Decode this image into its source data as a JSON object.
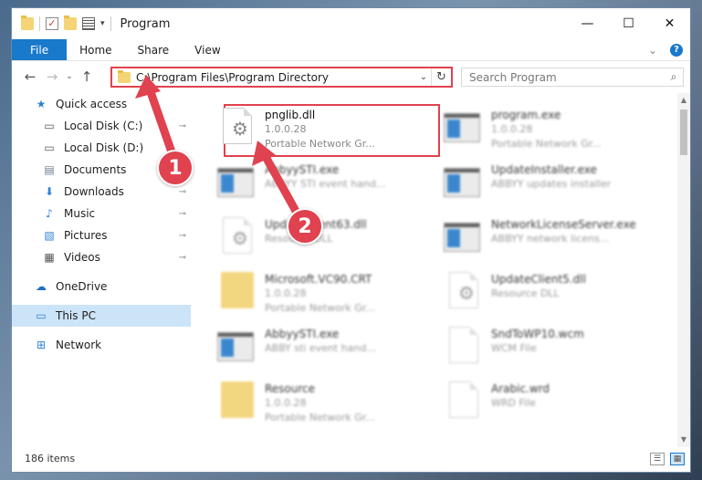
{
  "window": {
    "title": "Program",
    "controls": {
      "minimize": "—",
      "maximize": "☐",
      "close": "✕"
    }
  },
  "ribbon": {
    "tabs": [
      "File",
      "Home",
      "Share",
      "View"
    ],
    "expand": "⌄",
    "help": "?"
  },
  "address": {
    "path": "C:\\Program Files\\Program Directory",
    "dropdown": "⌄",
    "refresh": "↻",
    "back": "←",
    "forward": "→",
    "recent": "⌄",
    "up": "↑"
  },
  "search": {
    "placeholder": "Search Program",
    "icon": "⌕"
  },
  "sidebar": {
    "items": [
      {
        "label": "Quick access",
        "icon": "★",
        "pinned": false
      },
      {
        "label": "Local Disk (C:)",
        "icon": "▭",
        "pinned": true
      },
      {
        "label": "Local Disk (D:)",
        "icon": "▭",
        "pinned": false
      },
      {
        "label": "Documents",
        "icon": "▤",
        "pinned": false
      },
      {
        "label": "Downloads",
        "icon": "⬇",
        "pinned": true
      },
      {
        "label": "Music",
        "icon": "♪",
        "pinned": true
      },
      {
        "label": "Pictures",
        "icon": "▧",
        "pinned": true
      },
      {
        "label": "Videos",
        "icon": "▦",
        "pinned": true
      },
      {
        "label": "OneDrive",
        "icon": "☁",
        "pinned": false
      },
      {
        "label": "This PC",
        "icon": "▭",
        "pinned": false
      },
      {
        "label": "Network",
        "icon": "⊞",
        "pinned": false
      }
    ],
    "pin_glyph": "📌"
  },
  "files": [
    {
      "name": "pnglib.dll",
      "line2": "1.0.0.28",
      "line3": "Portable Network Gr...",
      "icon": "dll",
      "col": 0,
      "row": 0,
      "blurred": false
    },
    {
      "name": "program.exe",
      "line2": "1.0.0.28",
      "line3": "Portable Network Gr...",
      "icon": "exe",
      "col": 1,
      "row": 0,
      "blurred": true
    },
    {
      "name": "AbbyySTI.exe",
      "line2": "ABBYY STI event hand...",
      "line3": "",
      "icon": "exe",
      "col": 0,
      "row": 1,
      "blurred": true
    },
    {
      "name": "UpdateInstaller.exe",
      "line2": "ABBYY updates installer",
      "line3": "",
      "icon": "exe",
      "col": 1,
      "row": 1,
      "blurred": true
    },
    {
      "name": "UpdateClient63.dll",
      "line2": "Resource DLL",
      "line3": "",
      "icon": "dll",
      "col": 0,
      "row": 2,
      "blurred": true
    },
    {
      "name": "NetworkLicenseServer.exe",
      "line2": "ABBYY network licens...",
      "line3": "",
      "icon": "exe",
      "col": 1,
      "row": 2,
      "blurred": true
    },
    {
      "name": "Microsoft.VC90.CRT",
      "line2": "1.0.0.28",
      "line3": "Portable Network Gr...",
      "icon": "folder",
      "col": 0,
      "row": 3,
      "blurred": true
    },
    {
      "name": "UpdateClient5.dll",
      "line2": "Resource DLL",
      "line3": "",
      "icon": "dll",
      "col": 1,
      "row": 3,
      "blurred": true
    },
    {
      "name": "AbbyySTI.exe",
      "line2": "ABBY sti event hand...",
      "line3": "",
      "icon": "exe",
      "col": 0,
      "row": 4,
      "blurred": true
    },
    {
      "name": "SndToWP10.wcm",
      "line2": "WCM File",
      "line3": "",
      "icon": "doc",
      "col": 1,
      "row": 4,
      "blurred": true
    },
    {
      "name": "Resource",
      "line2": "1.0.0.28",
      "line3": "Portable Network Gr...",
      "icon": "folder",
      "col": 0,
      "row": 5,
      "blurred": true
    },
    {
      "name": "Arabic.wrd",
      "line2": "WRD File",
      "line3": "",
      "icon": "doc",
      "col": 1,
      "row": 5,
      "blurred": true
    }
  ],
  "status": {
    "count": "186 items"
  },
  "callouts": {
    "one": "1",
    "two": "2"
  },
  "colors": {
    "accent": "#1979ca",
    "highlight": "#e0424f",
    "selected": "#cce4f7"
  }
}
